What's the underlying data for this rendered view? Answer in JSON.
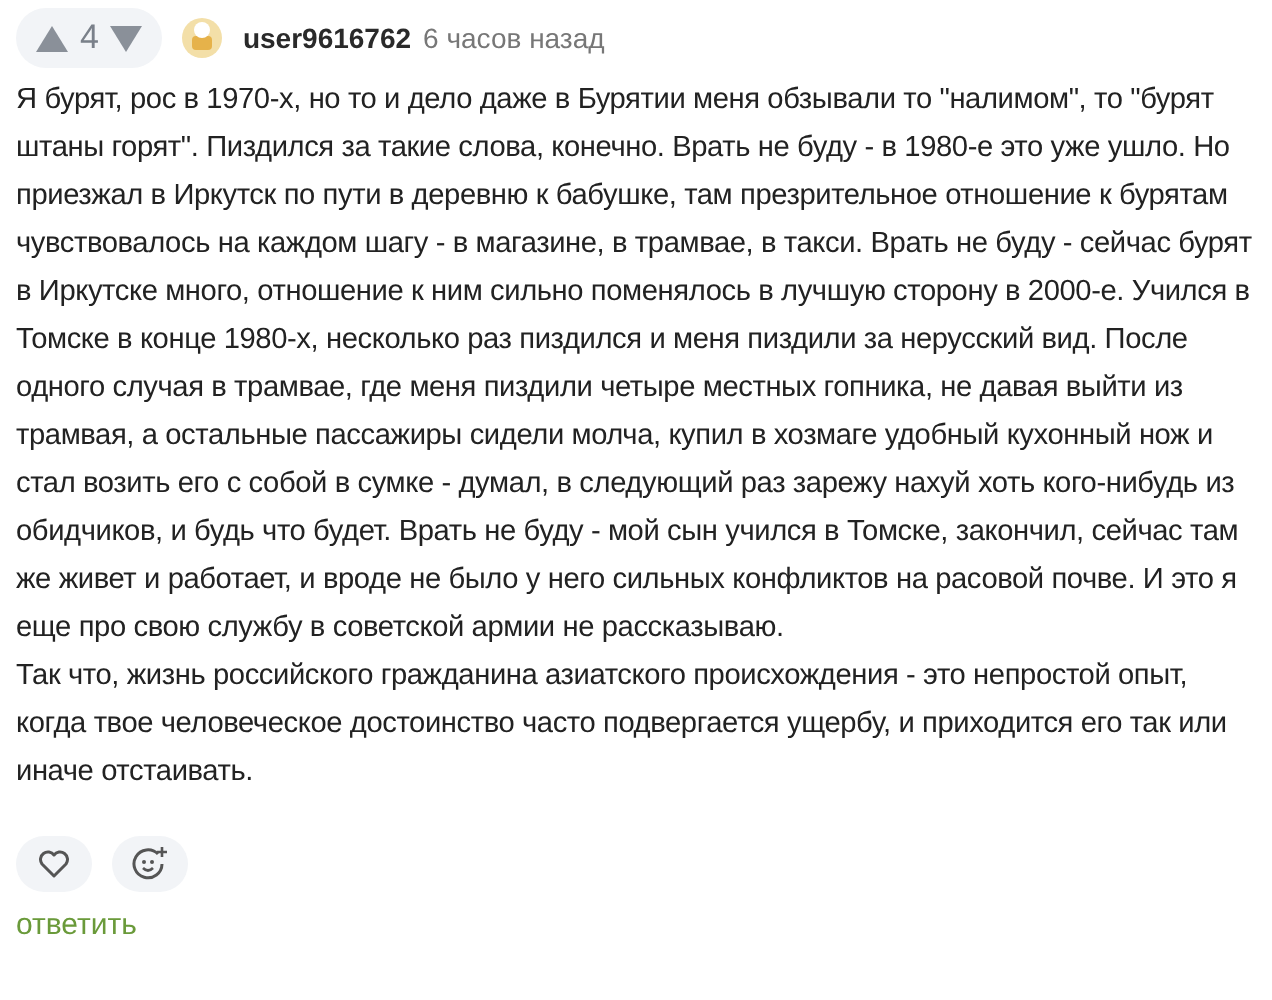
{
  "comment": {
    "score": "4",
    "author": "user9616762",
    "time": "6 часов назад",
    "paragraphs": [
      "Я бурят, рос в 1970-х, но то и дело даже в Бурятии меня обзывали то \"налимом\", то \"бурят штаны горят\". Пиздился за такие слова, конечно. Врать не буду - в 1980-е это уже ушло. Но приезжал в Иркутск по пути в деревню к бабушке, там презрительное отношение к бурятам чувствовалось на каждом шагу - в магазине, в трамвае, в такси. Врать не буду - сейчас бурят в Иркутске много, отношение к ним сильно поменялось в лучшую сторону в 2000-е. Учился в Томске в конце 1980-х, несколько раз пиздился и меня пиздили за нерусский вид. После одного случая в трамвае, где меня пиздили четыре местных гопника, не давая выйти из трамвая, а остальные пассажиры сидели молча, купил в хозмаге удобный кухонный нож и стал возить его с собой в сумке - думал, в следующий раз зарежу нахуй хоть кого-нибудь из обидчиков, и будь что будет. Врать не буду - мой сын учился в Томске, закончил, сейчас там же живет и работает, и вроде не было у него сильных конфликтов на расовой почве. И это я еще про свою службу в советской армии не рассказываю.",
      "Так что, жизнь российского гражданина азиатского происхождения - это непростой опыт, когда твое человеческое достоинство часто подвергается ущербу, и приходится его так или иначе отстаивать."
    ],
    "reply": "ответить"
  }
}
